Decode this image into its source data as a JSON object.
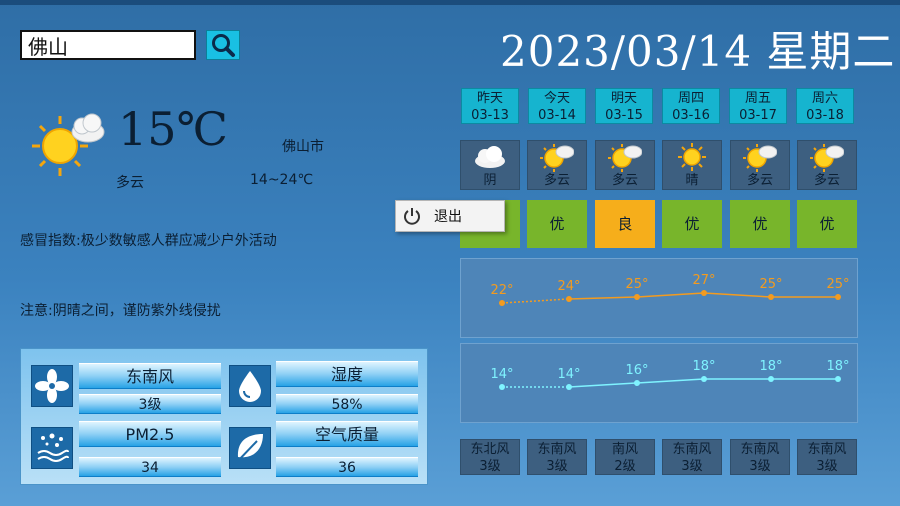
{
  "search": {
    "value": "佛山"
  },
  "date_title": "2023/03/14 星期二",
  "now": {
    "temp": "15℃",
    "city": "佛山市",
    "condition": "多云",
    "range": "14~24℃",
    "icon": "sun-cloud-icon"
  },
  "cold_index": "感冒指数:极少数敏感人群应减少户外活动",
  "notice": "注意:阴晴之间，谨防紫外线侵扰",
  "info": {
    "wind_dir": "东南风",
    "wind_level": "3级",
    "humidity_label": "湿度",
    "humidity_value": "58%",
    "pm_label": "PM2.5",
    "pm_value": "34",
    "aqi_label": "空气质量",
    "aqi_value": "36"
  },
  "colors": {
    "aqi_excellent": "#78b52b",
    "aqi_good": "#f6ae1b",
    "high_line": "#f39b1f",
    "low_line": "#7ff3ff"
  },
  "days": [
    {
      "name": "昨天",
      "date": "03-13",
      "cond": "阴",
      "icon": "cloud-icon",
      "aqi": "优",
      "high": "22°",
      "low": "14°",
      "wind": "东北风",
      "wind_level": "3级"
    },
    {
      "name": "今天",
      "date": "03-14",
      "cond": "多云",
      "icon": "sun-cloud-icon",
      "aqi": "优",
      "high": "24°",
      "low": "14°",
      "wind": "东南风",
      "wind_level": "3级"
    },
    {
      "name": "明天",
      "date": "03-15",
      "cond": "多云",
      "icon": "sun-cloud-icon",
      "aqi": "良",
      "high": "25°",
      "low": "16°",
      "wind": "南风",
      "wind_level": "2级"
    },
    {
      "name": "周四",
      "date": "03-16",
      "cond": "晴",
      "icon": "sun-icon",
      "aqi": "优",
      "high": "27°",
      "low": "18°",
      "wind": "东南风",
      "wind_level": "3级"
    },
    {
      "name": "周五",
      "date": "03-17",
      "cond": "多云",
      "icon": "sun-cloud-icon",
      "aqi": "优",
      "high": "25°",
      "low": "18°",
      "wind": "东南风",
      "wind_level": "3级"
    },
    {
      "name": "周六",
      "date": "03-18",
      "cond": "多云",
      "icon": "sun-cloud-icon",
      "aqi": "优",
      "high": "25°",
      "low": "18°",
      "wind": "东南风",
      "wind_level": "3级"
    }
  ],
  "chart_data": {
    "type": "line",
    "categories": [
      "03-13",
      "03-14",
      "03-15",
      "03-16",
      "03-17",
      "03-18"
    ],
    "series": [
      {
        "values": [
          22,
          24,
          25,
          27,
          25,
          25
        ]
      },
      {
        "values": [
          14,
          14,
          16,
          18,
          18,
          18
        ]
      }
    ]
  },
  "context_menu": {
    "exit_label": "退出",
    "icon": "power-icon"
  }
}
